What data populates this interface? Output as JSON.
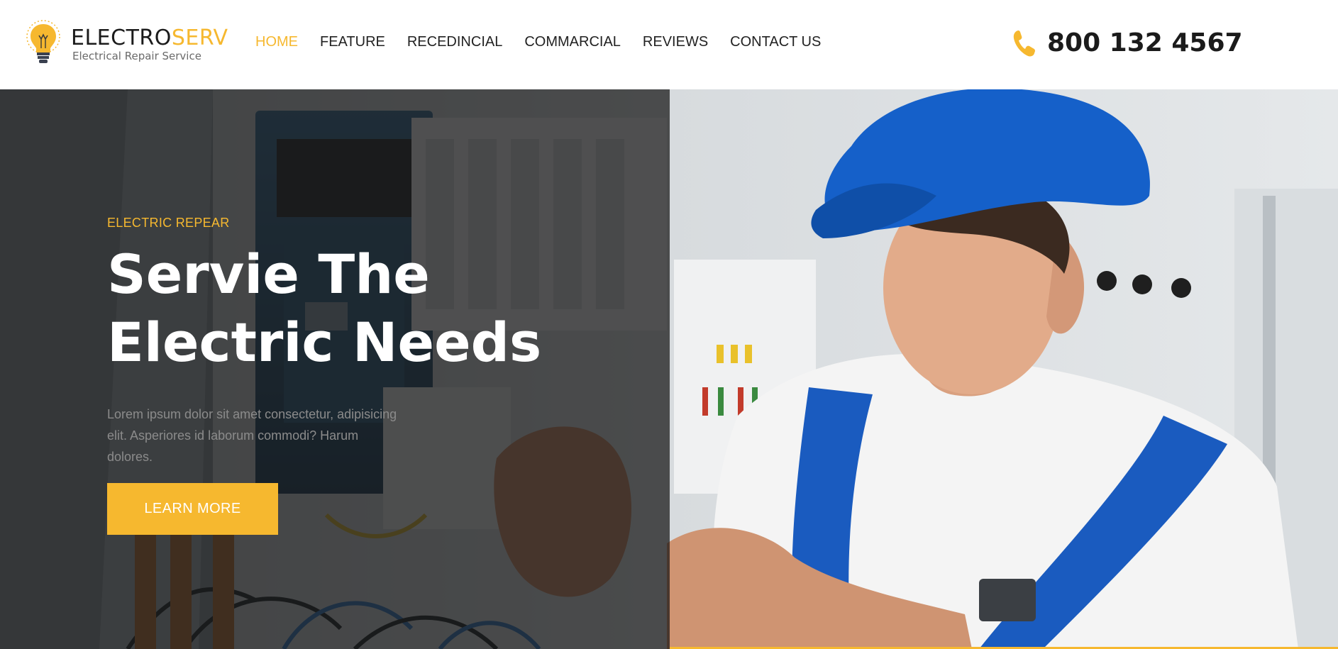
{
  "brand": {
    "name_part1": "ELECTRO",
    "name_part2": "SERV",
    "tagline": "Electrical Repair Service",
    "logo_icon": "lightbulb-icon"
  },
  "nav": {
    "items": [
      {
        "label": "HOME",
        "active": true
      },
      {
        "label": "FEATURE",
        "active": false
      },
      {
        "label": "RECEDINCIAL",
        "active": false
      },
      {
        "label": "COMMARCIAL",
        "active": false
      },
      {
        "label": "REVIEWS",
        "active": false
      },
      {
        "label": "CONTACT US",
        "active": false
      }
    ]
  },
  "contact": {
    "phone_icon": "phone-icon",
    "phone": "800 132 4567"
  },
  "hero": {
    "eyebrow": "ELECTRIC REPEAR",
    "headline": "Servie The Electric Needs",
    "description": "Lorem ipsum dolor sit amet consectetur, adipisicing elit. Asperiores id laborum commodi? Harum dolores.",
    "cta_label": "LEARN MORE"
  },
  "colors": {
    "accent": "#f6b82f",
    "text_dark": "#1b1b1b",
    "overlay": "#141414",
    "cap_blue": "#1560c9"
  }
}
